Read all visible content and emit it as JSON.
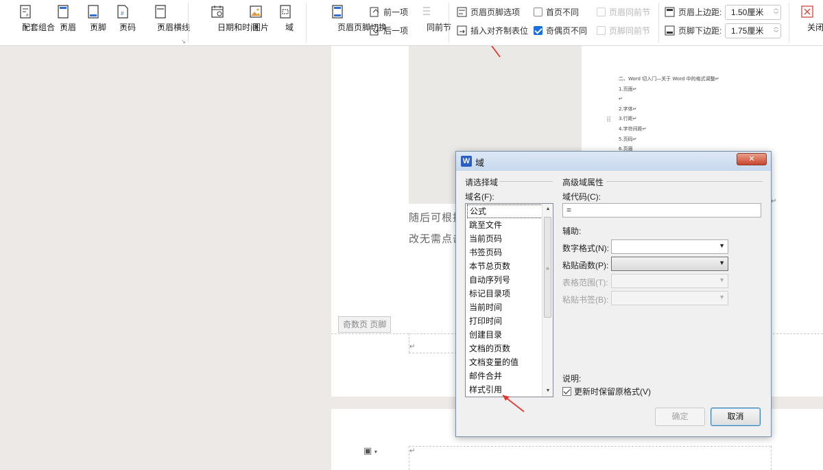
{
  "ribbon": {
    "group1": [
      {
        "name": "combo-button",
        "label": "配套组合",
        "icon": "combo-icon"
      },
      {
        "name": "header-button",
        "label": "页眉",
        "icon": "header-icon"
      },
      {
        "name": "footer-button",
        "label": "页脚",
        "icon": "footer-icon"
      },
      {
        "name": "page-number-button",
        "label": "页码",
        "icon": "page-number-icon"
      },
      {
        "name": "header-line-button",
        "label": "页眉横线",
        "icon": "header-line-icon"
      }
    ],
    "group2": [
      {
        "name": "date-time-button",
        "label": "日期和时间",
        "icon": "calendar-icon"
      },
      {
        "name": "picture-button",
        "label": "图片",
        "icon": "picture-icon"
      },
      {
        "name": "field-button",
        "label": "域",
        "icon": "field-icon"
      }
    ],
    "switch_label": "页眉页脚切换",
    "prev_label": "前一项",
    "next_label": "后一项",
    "same_section_label": "同前节",
    "hf_options_label": "页眉页脚选项",
    "insert_align_tab_label": "插入对齐制表位",
    "first_page_diff_label": "首页不同",
    "odd_even_diff_label": "奇偶页不同",
    "header_same_prev_label": "页眉同前节",
    "footer_same_prev_label": "页脚同前节",
    "header_top_margin_label": "页眉上边距:",
    "header_top_margin_value": "1.50厘米",
    "footer_bottom_margin_label": "页脚下边距:",
    "footer_bottom_margin_value": "1.75厘米",
    "close_label": "关闭"
  },
  "document": {
    "text_line1": "随后可根据",
    "text_line2": "改无需点击",
    "footer_tag": "奇数页 页脚",
    "mini_lines": [
      "二、Word 切入门—关于 Word 中的格式调整↵",
      "1.页面↵",
      "↵",
      "2.字体↵",
      "3.行距↵",
      "4.字符间距↵",
      "5.页码↵",
      "6.页眉"
    ]
  },
  "dialog": {
    "title": "域",
    "logo": "W",
    "left_group": "请选择域",
    "field_name_label": "域名(F):",
    "field_list": [
      "公式",
      "跳至文件",
      "当前页码",
      "书签页码",
      "本节总页数",
      "自动序列号",
      "标记目录项",
      "当前时间",
      "打印时间",
      "创建目录",
      "文档的页数",
      "文档变量的值",
      "邮件合并",
      "样式引用"
    ],
    "right_group": "高级域属性",
    "field_code_label": "域代码(C):",
    "field_code_value": "=",
    "assist_label": "辅助:",
    "number_format_label": "数字格式(N):",
    "paste_function_label": "粘贴函数(P):",
    "table_range_label": "表格范围(T):",
    "paste_bookmark_label": "粘贴书签(B):",
    "description_label": "说明:",
    "preserve_format_label": "更新时保留原格式(V)",
    "ok_label": "确定",
    "cancel_label": "取消"
  }
}
